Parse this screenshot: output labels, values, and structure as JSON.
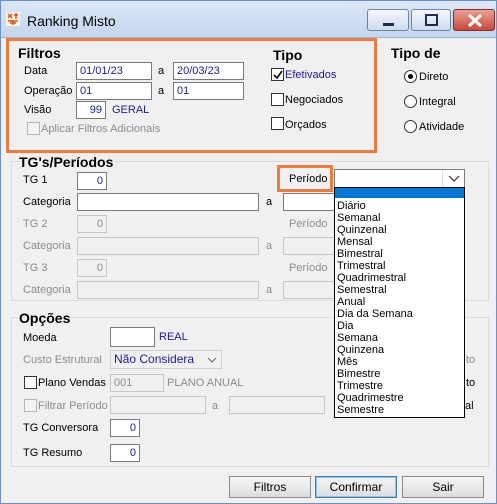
{
  "window": {
    "title": "Ranking Misto"
  },
  "filtros": {
    "title": "Filtros",
    "data_label": "Data",
    "data_from": "01/01/23",
    "data_sep": "a",
    "data_to": "20/03/23",
    "operacao_label": "Operação",
    "operacao_from": "01",
    "operacao_sep": "a",
    "operacao_to": "01",
    "visao_label": "Visão",
    "visao_value": "99",
    "visao_desc": "GERAL",
    "aplicar_label": "Aplicar Filtros Adicionais"
  },
  "tipo": {
    "title": "Tipo",
    "efetivados_label": "Efetivados",
    "negociados_label": "Negociados",
    "orcados_label": "Orçados"
  },
  "tipo_de": {
    "title": "Tipo de",
    "direto_label": "Direto",
    "integral_label": "Integral",
    "atividade_label": "Atividade"
  },
  "tgs": {
    "title": "TG's/Períodos",
    "tg1_label": "TG 1",
    "tg1_value": "0",
    "categoria1_label": "Categoria",
    "sep": "a",
    "tg2_label": "TG 2",
    "tg2_value": "0",
    "categoria2_label": "Categoria",
    "tg3_label": "TG 3",
    "tg3_value": "0",
    "categoria3_label": "Categoria",
    "periodo_label": "Período",
    "periodo2_label": "Período",
    "periodo3_label": "Período",
    "periodo_options": [
      "Diário",
      "Semanal",
      "Quinzenal",
      "Mensal",
      "Bimestral",
      "Trimestral",
      "Quadrimestral",
      "Semestral",
      "Anual",
      "Dia da Semana",
      "Dia",
      "Semana",
      "Quinzena",
      "Mês",
      "Bimestre",
      "Trimestre",
      "Quadrimestre",
      "Semestre"
    ]
  },
  "opcoes": {
    "title": "Opções",
    "moeda_label": "Moeda",
    "moeda_desc": "REAL",
    "custo_label": "Custo Estrutural",
    "custo_value": "Não Considera",
    "plano_label": "Plano Vendas",
    "plano_value": "001",
    "plano_desc": "PLANO ANUAL",
    "filtrar_label": "Filtrar Período",
    "filtrar_sep": "a",
    "tg_conversora_label": "TG Conversora",
    "tg_conversora_value": "0",
    "tg_resumo_label": "TG Resumo",
    "tg_resumo_value": "0",
    "partial_right_1": "to",
    "partial_right_2": "to",
    "partial_right_3": "al"
  },
  "buttons": {
    "filtros": "Filtros",
    "confirmar": "Confirmar",
    "sair": "Sair"
  },
  "colors": {
    "highlight": "#f07b3f",
    "value_text": "#1b1b9a"
  }
}
